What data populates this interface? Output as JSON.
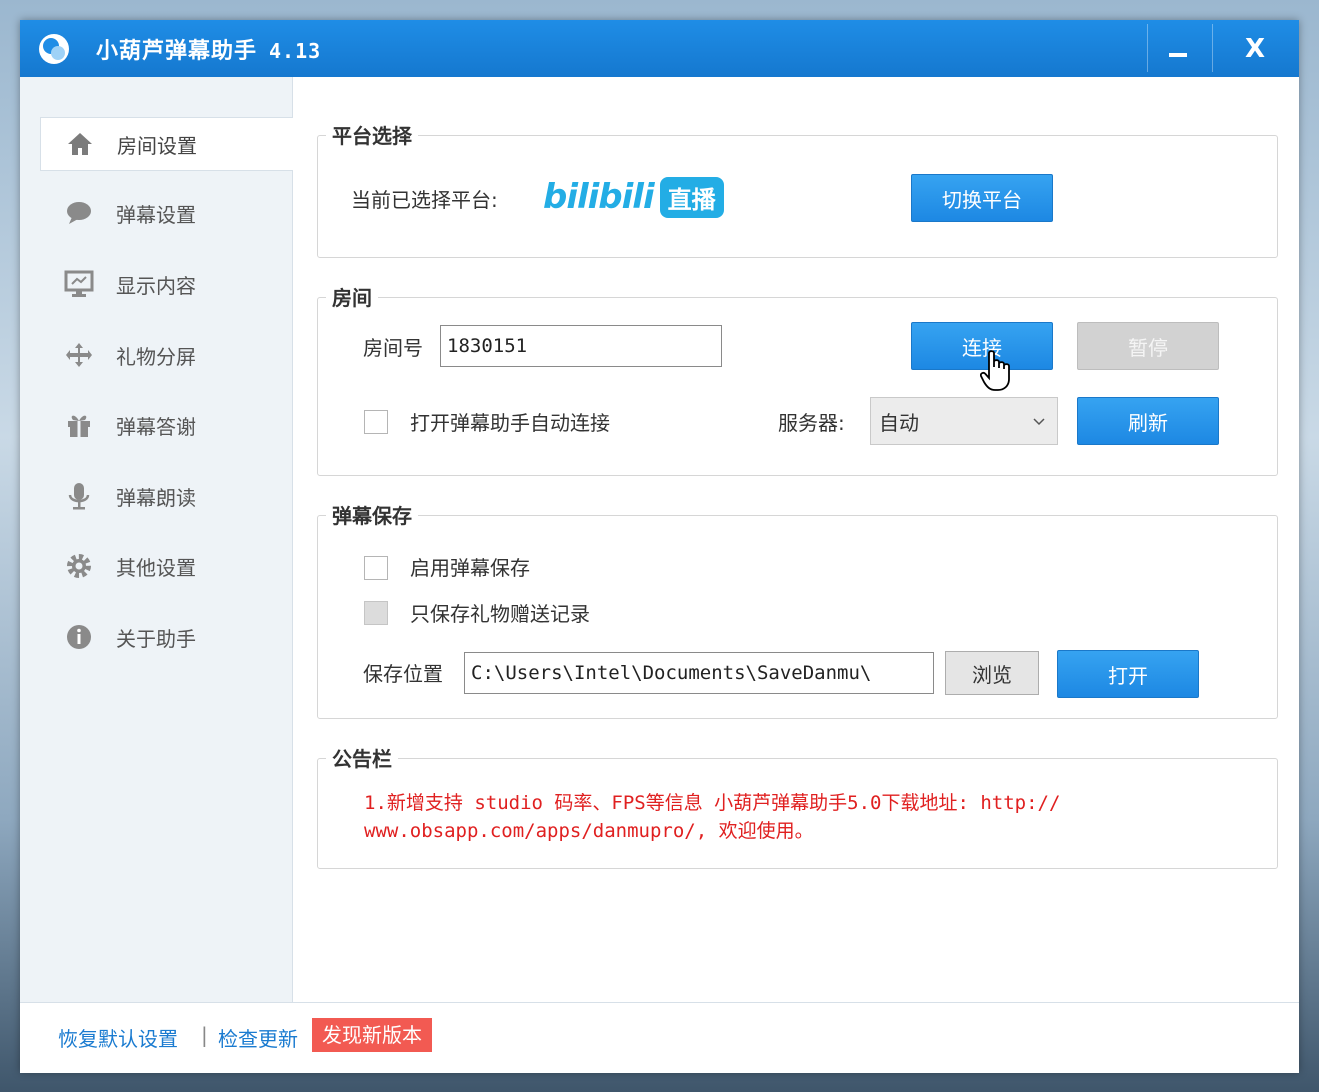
{
  "titlebar": {
    "title": "小葫芦弹幕助手",
    "version": "4.13",
    "minimize_icon": "minimize-icon",
    "close_label": "X"
  },
  "sidebar": {
    "items": [
      {
        "label": "房间设置",
        "icon": "home-icon"
      },
      {
        "label": "弹幕设置",
        "icon": "chat-bubble-icon"
      },
      {
        "label": "显示内容",
        "icon": "monitor-icon"
      },
      {
        "label": "礼物分屏",
        "icon": "split-arrows-icon"
      },
      {
        "label": "弹幕答谢",
        "icon": "gift-icon"
      },
      {
        "label": "弹幕朗读",
        "icon": "microphone-icon"
      },
      {
        "label": "其他设置",
        "icon": "gear-icon"
      },
      {
        "label": "关于助手",
        "icon": "info-icon"
      }
    ]
  },
  "platform": {
    "legend": "平台选择",
    "current_label": "当前已选择平台:",
    "logo_text": "bilibili",
    "logo_badge": "直播",
    "switch_button": "切换平台",
    "brand_color": "#23ade5"
  },
  "room": {
    "legend": "房间",
    "room_no_label": "房间号",
    "room_no_value": "1830151",
    "connect_button": "连接",
    "pause_button": "暂停",
    "auto_connect_label": "打开弹幕助手自动连接",
    "server_label": "服务器:",
    "server_value": "自动",
    "refresh_button": "刷新"
  },
  "save": {
    "legend": "弹幕保存",
    "enable_label": "启用弹幕保存",
    "gift_only_label": "只保存礼物赠送记录",
    "path_label": "保存位置",
    "path_value": "C:\\Users\\Intel\\Documents\\SaveDanmu\\",
    "browse_button": "浏览",
    "open_button": "打开"
  },
  "notice": {
    "legend": "公告栏",
    "line1": "1.新增支持 studio 码率、FPS等信息 小葫芦弹幕助手5.0下载地址: http://",
    "line2": "www.obsapp.com/apps/danmupro/, 欢迎使用。",
    "color": "#e02020"
  },
  "footer": {
    "restore_link": "恢复默认设置",
    "separator": "|",
    "update_link": "检查更新",
    "new_version_badge": "发现新版本"
  }
}
